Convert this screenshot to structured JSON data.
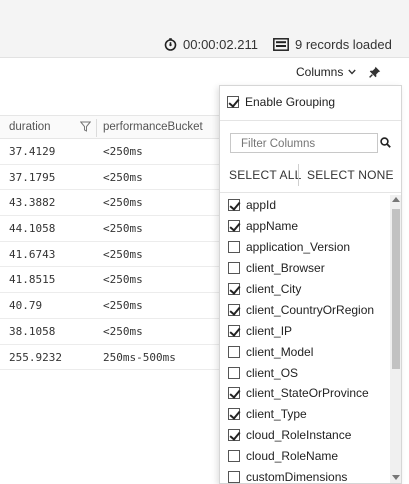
{
  "status": {
    "timer_text": "00:00:02.211",
    "records_text": "9 records loaded"
  },
  "toolbar": {
    "columns_label": "Columns"
  },
  "table": {
    "headers": [
      "duration",
      "performanceBucket"
    ],
    "rows": [
      [
        "37.4129",
        "<250ms"
      ],
      [
        "37.1795",
        "<250ms"
      ],
      [
        "43.3882",
        "<250ms"
      ],
      [
        "44.1058",
        "<250ms"
      ],
      [
        "41.6743",
        "<250ms"
      ],
      [
        "41.8515",
        "<250ms"
      ],
      [
        "40.79",
        "<250ms"
      ],
      [
        "38.1058",
        "<250ms"
      ],
      [
        "255.9232",
        "250ms-500ms"
      ]
    ]
  },
  "panel": {
    "enable_grouping_label": "Enable Grouping",
    "enable_grouping_checked": true,
    "filter_placeholder": "Filter Columns",
    "select_all_label": "SELECT ALL",
    "select_none_label": "SELECT NONE",
    "columns": [
      {
        "label": "appId",
        "checked": true
      },
      {
        "label": "appName",
        "checked": true
      },
      {
        "label": "application_Version",
        "checked": false
      },
      {
        "label": "client_Browser",
        "checked": false
      },
      {
        "label": "client_City",
        "checked": true
      },
      {
        "label": "client_CountryOrRegion",
        "checked": true
      },
      {
        "label": "client_IP",
        "checked": true
      },
      {
        "label": "client_Model",
        "checked": false
      },
      {
        "label": "client_OS",
        "checked": false
      },
      {
        "label": "client_StateOrProvince",
        "checked": true
      },
      {
        "label": "client_Type",
        "checked": true
      },
      {
        "label": "cloud_RoleInstance",
        "checked": true
      },
      {
        "label": "cloud_RoleName",
        "checked": false
      },
      {
        "label": "customDimensions",
        "checked": false
      }
    ]
  },
  "icons": {
    "timer": "stopwatch-icon",
    "records": "records-icon",
    "columns_dropdown": "chevron-down-icon",
    "pin": "pin-icon",
    "column_filter": "funnel-icon",
    "search": "search-icon"
  }
}
